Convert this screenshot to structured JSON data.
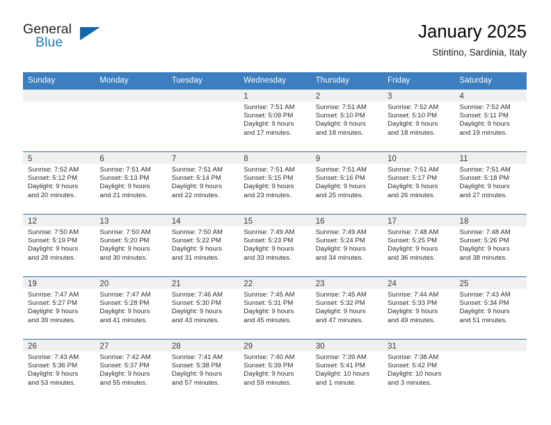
{
  "brand": {
    "name_top": "General",
    "name_bottom": "Blue"
  },
  "header": {
    "title": "January 2025",
    "location": "Stintino, Sardinia, Italy"
  },
  "colors": {
    "header_blue": "#3c7ebf",
    "separator_blue": "#2e6daf",
    "date_strip": "#f0f0f0",
    "brand_blue": "#1b7bc1"
  },
  "weekdays": [
    "Sunday",
    "Monday",
    "Tuesday",
    "Wednesday",
    "Thursday",
    "Friday",
    "Saturday"
  ],
  "weeks": [
    [
      {
        "day": "",
        "lines": []
      },
      {
        "day": "",
        "lines": []
      },
      {
        "day": "",
        "lines": []
      },
      {
        "day": "1",
        "lines": [
          "Sunrise: 7:51 AM",
          "Sunset: 5:09 PM",
          "Daylight: 9 hours",
          "and 17 minutes."
        ]
      },
      {
        "day": "2",
        "lines": [
          "Sunrise: 7:51 AM",
          "Sunset: 5:10 PM",
          "Daylight: 9 hours",
          "and 18 minutes."
        ]
      },
      {
        "day": "3",
        "lines": [
          "Sunrise: 7:52 AM",
          "Sunset: 5:10 PM",
          "Daylight: 9 hours",
          "and 18 minutes."
        ]
      },
      {
        "day": "4",
        "lines": [
          "Sunrise: 7:52 AM",
          "Sunset: 5:11 PM",
          "Daylight: 9 hours",
          "and 19 minutes."
        ]
      }
    ],
    [
      {
        "day": "5",
        "lines": [
          "Sunrise: 7:52 AM",
          "Sunset: 5:12 PM",
          "Daylight: 9 hours",
          "and 20 minutes."
        ]
      },
      {
        "day": "6",
        "lines": [
          "Sunrise: 7:51 AM",
          "Sunset: 5:13 PM",
          "Daylight: 9 hours",
          "and 21 minutes."
        ]
      },
      {
        "day": "7",
        "lines": [
          "Sunrise: 7:51 AM",
          "Sunset: 5:14 PM",
          "Daylight: 9 hours",
          "and 22 minutes."
        ]
      },
      {
        "day": "8",
        "lines": [
          "Sunrise: 7:51 AM",
          "Sunset: 5:15 PM",
          "Daylight: 9 hours",
          "and 23 minutes."
        ]
      },
      {
        "day": "9",
        "lines": [
          "Sunrise: 7:51 AM",
          "Sunset: 5:16 PM",
          "Daylight: 9 hours",
          "and 25 minutes."
        ]
      },
      {
        "day": "10",
        "lines": [
          "Sunrise: 7:51 AM",
          "Sunset: 5:17 PM",
          "Daylight: 9 hours",
          "and 26 minutes."
        ]
      },
      {
        "day": "11",
        "lines": [
          "Sunrise: 7:51 AM",
          "Sunset: 5:18 PM",
          "Daylight: 9 hours",
          "and 27 minutes."
        ]
      }
    ],
    [
      {
        "day": "12",
        "lines": [
          "Sunrise: 7:50 AM",
          "Sunset: 5:19 PM",
          "Daylight: 9 hours",
          "and 28 minutes."
        ]
      },
      {
        "day": "13",
        "lines": [
          "Sunrise: 7:50 AM",
          "Sunset: 5:20 PM",
          "Daylight: 9 hours",
          "and 30 minutes."
        ]
      },
      {
        "day": "14",
        "lines": [
          "Sunrise: 7:50 AM",
          "Sunset: 5:22 PM",
          "Daylight: 9 hours",
          "and 31 minutes."
        ]
      },
      {
        "day": "15",
        "lines": [
          "Sunrise: 7:49 AM",
          "Sunset: 5:23 PM",
          "Daylight: 9 hours",
          "and 33 minutes."
        ]
      },
      {
        "day": "16",
        "lines": [
          "Sunrise: 7:49 AM",
          "Sunset: 5:24 PM",
          "Daylight: 9 hours",
          "and 34 minutes."
        ]
      },
      {
        "day": "17",
        "lines": [
          "Sunrise: 7:48 AM",
          "Sunset: 5:25 PM",
          "Daylight: 9 hours",
          "and 36 minutes."
        ]
      },
      {
        "day": "18",
        "lines": [
          "Sunrise: 7:48 AM",
          "Sunset: 5:26 PM",
          "Daylight: 9 hours",
          "and 38 minutes."
        ]
      }
    ],
    [
      {
        "day": "19",
        "lines": [
          "Sunrise: 7:47 AM",
          "Sunset: 5:27 PM",
          "Daylight: 9 hours",
          "and 39 minutes."
        ]
      },
      {
        "day": "20",
        "lines": [
          "Sunrise: 7:47 AM",
          "Sunset: 5:28 PM",
          "Daylight: 9 hours",
          "and 41 minutes."
        ]
      },
      {
        "day": "21",
        "lines": [
          "Sunrise: 7:46 AM",
          "Sunset: 5:30 PM",
          "Daylight: 9 hours",
          "and 43 minutes."
        ]
      },
      {
        "day": "22",
        "lines": [
          "Sunrise: 7:45 AM",
          "Sunset: 5:31 PM",
          "Daylight: 9 hours",
          "and 45 minutes."
        ]
      },
      {
        "day": "23",
        "lines": [
          "Sunrise: 7:45 AM",
          "Sunset: 5:32 PM",
          "Daylight: 9 hours",
          "and 47 minutes."
        ]
      },
      {
        "day": "24",
        "lines": [
          "Sunrise: 7:44 AM",
          "Sunset: 5:33 PM",
          "Daylight: 9 hours",
          "and 49 minutes."
        ]
      },
      {
        "day": "25",
        "lines": [
          "Sunrise: 7:43 AM",
          "Sunset: 5:34 PM",
          "Daylight: 9 hours",
          "and 51 minutes."
        ]
      }
    ],
    [
      {
        "day": "26",
        "lines": [
          "Sunrise: 7:43 AM",
          "Sunset: 5:36 PM",
          "Daylight: 9 hours",
          "and 53 minutes."
        ]
      },
      {
        "day": "27",
        "lines": [
          "Sunrise: 7:42 AM",
          "Sunset: 5:37 PM",
          "Daylight: 9 hours",
          "and 55 minutes."
        ]
      },
      {
        "day": "28",
        "lines": [
          "Sunrise: 7:41 AM",
          "Sunset: 5:38 PM",
          "Daylight: 9 hours",
          "and 57 minutes."
        ]
      },
      {
        "day": "29",
        "lines": [
          "Sunrise: 7:40 AM",
          "Sunset: 5:39 PM",
          "Daylight: 9 hours",
          "and 59 minutes."
        ]
      },
      {
        "day": "30",
        "lines": [
          "Sunrise: 7:39 AM",
          "Sunset: 5:41 PM",
          "Daylight: 10 hours",
          "and 1 minute."
        ]
      },
      {
        "day": "31",
        "lines": [
          "Sunrise: 7:38 AM",
          "Sunset: 5:42 PM",
          "Daylight: 10 hours",
          "and 3 minutes."
        ]
      },
      {
        "day": "",
        "lines": []
      }
    ]
  ]
}
